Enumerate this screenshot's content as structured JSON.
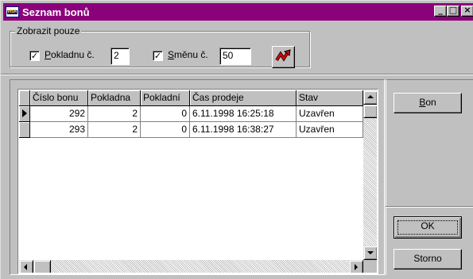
{
  "window": {
    "title": "Seznam bonů",
    "app_icon_text": "VISA",
    "controls": {
      "minimize": "_",
      "maximize": "□",
      "close": "×"
    }
  },
  "filter": {
    "group_label": "Zobrazit pouze",
    "pokladna": {
      "checked": true,
      "label_prefix": "",
      "label_underlined": "P",
      "label_rest": "okladnu č.",
      "value": "2"
    },
    "smena": {
      "checked": true,
      "label_underlined": "S",
      "label_rest": "měnu č.",
      "value": "50"
    },
    "refresh_icon": "refresh-arrow-icon"
  },
  "grid": {
    "columns": [
      "Číslo bonu",
      "Pokladna",
      "Pokladní",
      "Čas prodeje",
      "Stav"
    ],
    "rows": [
      {
        "current": true,
        "cells": [
          "292",
          "2",
          "0",
          "6.11.1998 16:25:18",
          "Uzavřen"
        ]
      },
      {
        "current": false,
        "cells": [
          "293",
          "2",
          "0",
          "6.11.1998 16:38:27",
          "Uzavřen"
        ]
      }
    ]
  },
  "buttons": {
    "bon": {
      "underlined": "B",
      "rest": "on"
    },
    "ok": "OK",
    "storno": "Storno"
  },
  "colors": {
    "titlebar": "#8b007b",
    "face": "#c0c0c0",
    "refresh_icon": "#e00000"
  }
}
